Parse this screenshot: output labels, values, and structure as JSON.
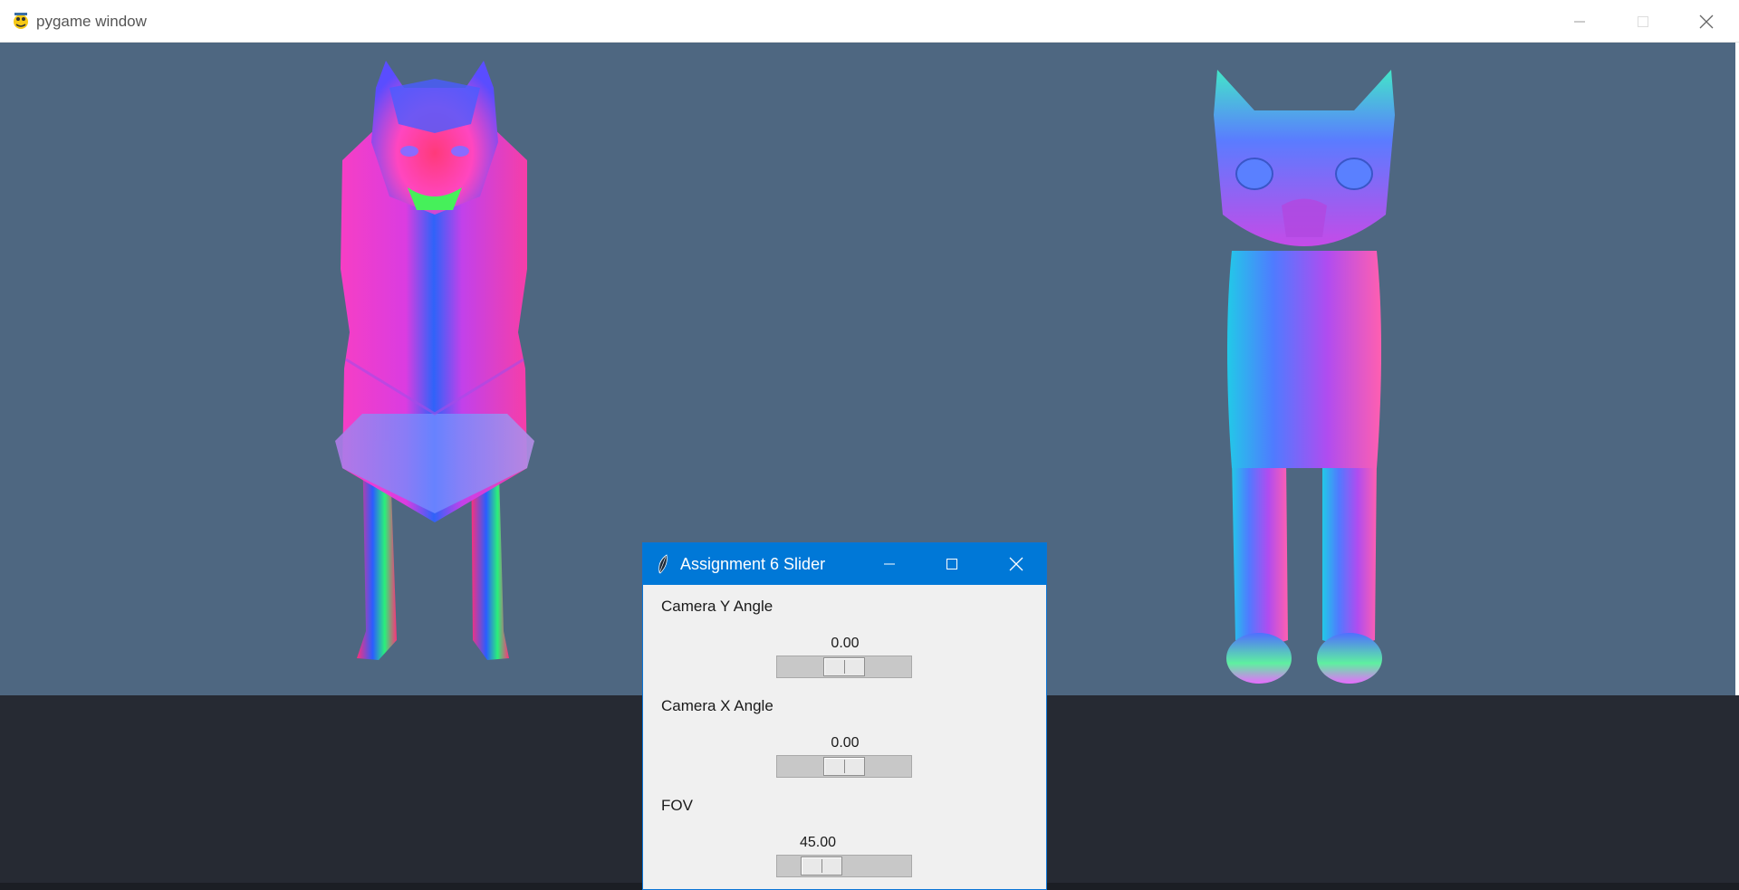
{
  "pygame_window": {
    "title": "pygame window",
    "icon": "pygame-snake-icon",
    "controls": [
      "minimize-icon",
      "maximize-icon",
      "close-icon"
    ],
    "background_color": "#4e6781"
  },
  "scene": {
    "models": [
      {
        "name": "wolf",
        "shading": "normal-map colors"
      },
      {
        "name": "cat",
        "shading": "normal-map colors"
      }
    ]
  },
  "slider_window": {
    "title": "Assignment 6 Slider",
    "icon": "tk-feather-icon",
    "titlebar_color": "#0078d7",
    "sliders": [
      {
        "label": "Camera Y Angle",
        "value": "0.00",
        "fraction": 0.5
      },
      {
        "label": "Camera X Angle",
        "value": "0.00",
        "fraction": 0.5
      },
      {
        "label": "FOV",
        "value": "45.00",
        "fraction": 0.25
      }
    ]
  }
}
